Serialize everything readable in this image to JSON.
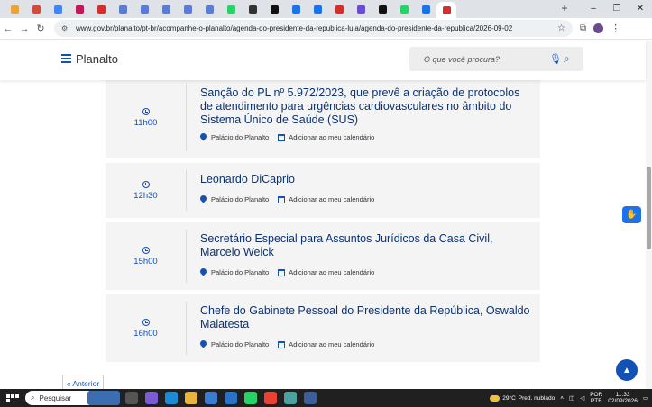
{
  "browser": {
    "url": "www.gov.br/planalto/pt-br/acompanhe-o-planalto/agenda-do-presidente-da-republica-lula/agenda-do-presidente-da-republica/2026-09-02",
    "tab_colors": [
      "#e8a33c",
      "#d34a3e",
      "#4285f4",
      "#c2185b",
      "#d32f2f",
      "#5b7bd5",
      "#5b7bd5",
      "#5b7bd5",
      "#5b7bd5",
      "#5b7bd5",
      "#25d366",
      "#333",
      "#111",
      "#1a73e8",
      "#1a73e8",
      "#d32f2f",
      "#6c4cd1",
      "#111",
      "#25d366",
      "#1a73e8",
      "#d32f2f"
    ],
    "new_tab": "+",
    "win_minimize": "–",
    "win_maximize": "❐",
    "win_close": "✕"
  },
  "header": {
    "brand": "Planalto",
    "search_placeholder": "O que você procura?"
  },
  "events": [
    {
      "time": "11h00",
      "title": "Sanção do PL nº 5.972/2023, que prevê a criação de protocolos de atendimento para urgências cardiovasculares no âmbito do Sistema Único de Saúde (SUS)",
      "location": "Palácio do Planalto",
      "calendar": "Adicionar ao meu calendário"
    },
    {
      "time": "12h30",
      "title": "Leonardo DiCaprio",
      "location": "Palácio do Planalto",
      "calendar": "Adicionar ao meu calendário"
    },
    {
      "time": "15h00",
      "title": "Secretário Especial para Assuntos Jurídicos da Casa Civil, Marcelo Weick",
      "location": "Palácio do Planalto",
      "calendar": "Adicionar ao meu calendário"
    },
    {
      "time": "16h00",
      "title": "Chefe do Gabinete Pessoal do Presidente da República, Oswaldo Malatesta",
      "location": "Palácio do Planalto",
      "calendar": "Adicionar ao meu calendário"
    }
  ],
  "pagination": {
    "prev": "« Anterior"
  },
  "taskbar": {
    "search": "Pesquisar",
    "weather_temp": "29°C",
    "weather_desc": "Pred. nublado",
    "lang_1": "POR",
    "lang_2": "PTB",
    "time": "11:33",
    "date": "02/09/2026"
  }
}
